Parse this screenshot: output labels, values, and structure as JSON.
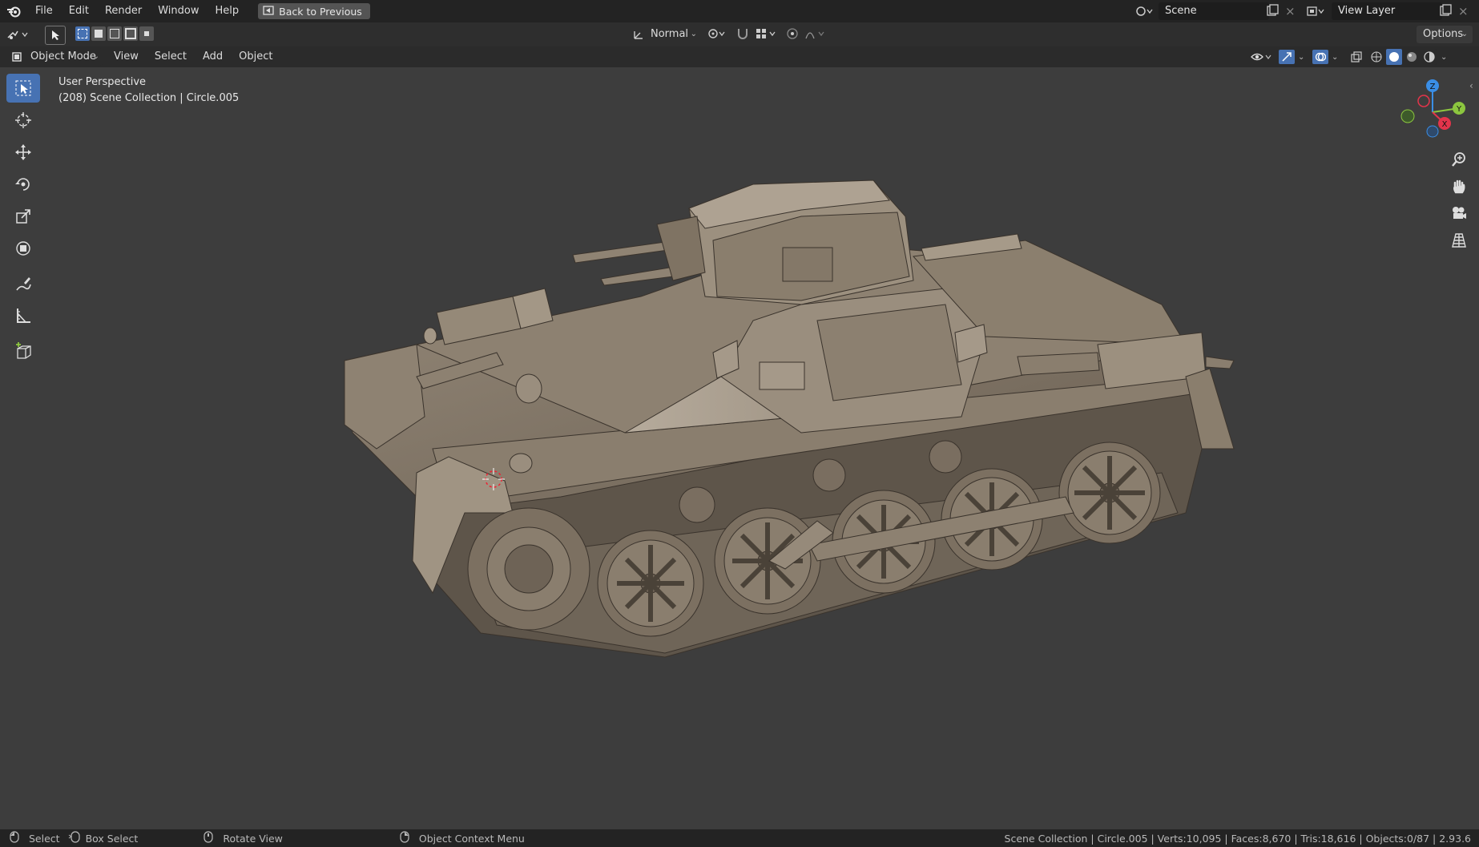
{
  "topbar": {
    "menus": [
      "File",
      "Edit",
      "Render",
      "Window",
      "Help"
    ],
    "back_label": "Back to Previous",
    "scene_label": "Scene",
    "view_layer_label": "View Layer"
  },
  "tool_header": {
    "orientation": "Normal",
    "options_label": "Options"
  },
  "viewport_header": {
    "mode": "Object Mode",
    "menus": [
      "View",
      "Select",
      "Add",
      "Object"
    ]
  },
  "viewport": {
    "perspective": "User Perspective",
    "collection_info": "(208) Scene Collection | Circle.005"
  },
  "gizmo": {
    "x": "X",
    "y": "Y",
    "z": "Z"
  },
  "tools": [
    "select-box",
    "cursor",
    "move",
    "rotate",
    "scale",
    "transform",
    "annotate",
    "measure",
    "add-cube"
  ],
  "statusbar": {
    "select": "Select",
    "box_select": "Box Select",
    "rotate_view": "Rotate View",
    "context_menu": "Object Context Menu",
    "stats": "Scene Collection | Circle.005 | Verts:10,095 | Faces:8,670 | Tris:18,616 | Objects:0/87 | 2.93.6"
  },
  "colors": {
    "accent": "#4772b3",
    "axis_x": "#e3344b",
    "axis_y": "#8cc63f",
    "axis_z": "#3a8ee6",
    "model": "#7e7264"
  }
}
